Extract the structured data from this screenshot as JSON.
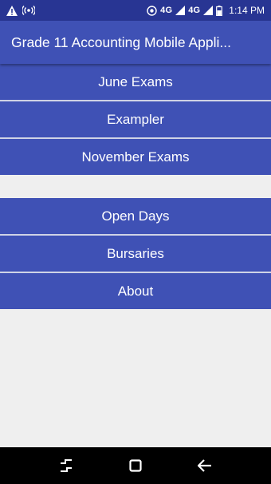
{
  "status_bar": {
    "left_icons": [
      "warning-icon",
      "broadcast-icon"
    ],
    "right_icons": [
      "hotspot-icon",
      "signal-icon",
      "signal-icon",
      "battery-icon"
    ],
    "network_1": "4G",
    "network_2": "4G",
    "time": "1:14 PM"
  },
  "app_bar": {
    "title": "Grade 11 Accounting Mobile Appli..."
  },
  "menu_group_1": [
    {
      "label": "June Exams"
    },
    {
      "label": "Exampler"
    },
    {
      "label": "November Exams"
    }
  ],
  "menu_group_2": [
    {
      "label": "Open Days"
    },
    {
      "label": "Bursaries"
    },
    {
      "label": "About"
    }
  ],
  "nav_bar": {
    "buttons": [
      "recents-icon",
      "home-icon",
      "back-icon"
    ]
  },
  "colors": {
    "primary": "#3f51b5",
    "primary_dark": "#283593",
    "background": "#efefef",
    "nav_bar": "#000000"
  }
}
